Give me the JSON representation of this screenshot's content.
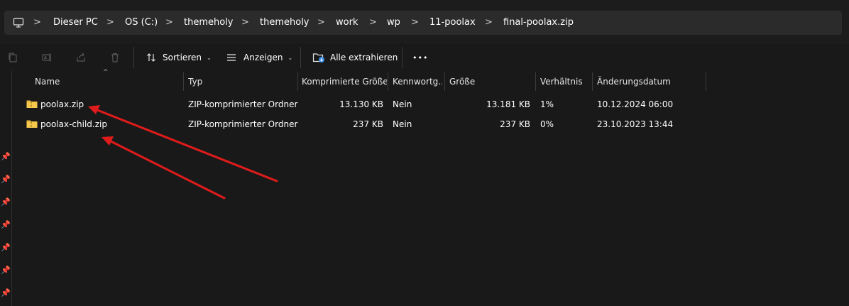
{
  "breadcrumb": {
    "items": [
      "Dieser PC",
      "OS (C:)",
      "themeholy",
      "themeholy",
      "work",
      "wp",
      "11-poolax",
      "final-poolax.zip"
    ],
    "separator": ">"
  },
  "toolbar": {
    "sort_label": "Sortieren",
    "view_label": "Anzeigen",
    "extract_label": "Alle extrahieren",
    "more_label": "•••"
  },
  "columns": [
    "Name",
    "Typ",
    "Komprimierte Größe",
    "Kennwortg...",
    "Größe",
    "Verhältnis",
    "Änderungsdatum"
  ],
  "files": [
    {
      "name": "poolax.zip",
      "type": "ZIP-komprimierter Ordner",
      "compressed_size": "13.130 KB",
      "password": "Nein",
      "size": "13.181 KB",
      "ratio": "1%",
      "modified": "10.12.2024 06:00"
    },
    {
      "name": "poolax-child.zip",
      "type": "ZIP-komprimierter Ordner",
      "compressed_size": "237 KB",
      "password": "Nein",
      "size": "237 KB",
      "ratio": "0%",
      "modified": "23.10.2023 13:44"
    }
  ],
  "colors": {
    "background": "#191919",
    "addressbar": "#2b2b2b",
    "annotation_arrow": "#e01b1b",
    "folder_zip": "#e8b53a"
  }
}
